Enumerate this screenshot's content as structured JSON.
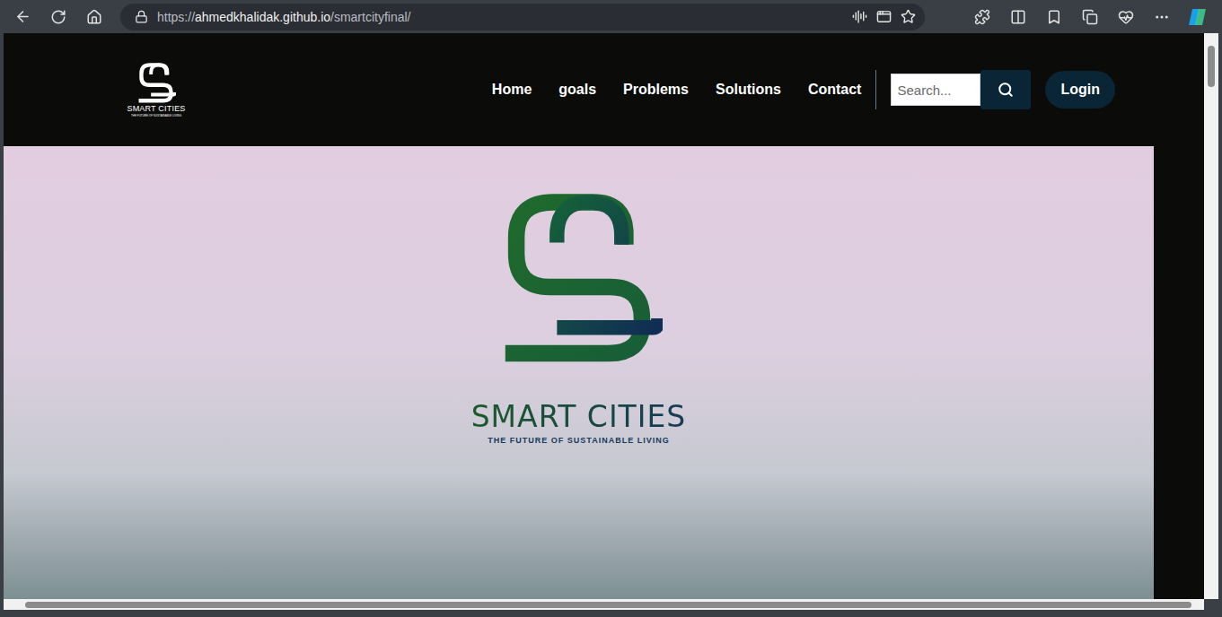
{
  "browser": {
    "url_scheme": "https://",
    "url_host": "ahmedkhalidak.github.io",
    "url_path": "/smartcityfinal/"
  },
  "nav": {
    "logo": {
      "title": "SMART CITIES",
      "tagline": "THE FUTURE OF SUSTAINABLE LIVING"
    },
    "links": [
      "Home",
      "goals",
      "Problems",
      "Solutions",
      "Contact"
    ],
    "search": {
      "placeholder": "Search..."
    },
    "login": "Login"
  },
  "hero": {
    "title": "SMART CITIES",
    "tagline": "THE FUTURE OF SUSTAINABLE LIVING"
  }
}
